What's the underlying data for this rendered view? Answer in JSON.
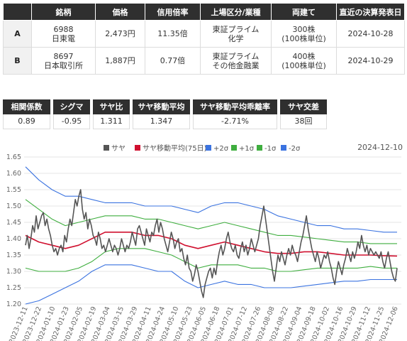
{
  "table": {
    "headers": [
      "",
      "銘柄",
      "価格",
      "信用倍率",
      "上場区分/業種",
      "両建て",
      "直近の決算発表日"
    ],
    "rows": [
      {
        "label": "A",
        "code": "6988",
        "name": "日東電",
        "price": "2,473円",
        "margin_ratio": "11.35倍",
        "market": "東証プライム",
        "sector": "化学",
        "position": "300株",
        "unit": "(100株単位)",
        "earnings_date": "2024-10-28"
      },
      {
        "label": "B",
        "code": "8697",
        "name": "日本取引所",
        "price": "1,887円",
        "margin_ratio": "0.77倍",
        "market": "東証プライム",
        "sector": "その他金融業",
        "position": "400株",
        "unit": "(100株単位)",
        "earnings_date": "2024-10-29"
      }
    ]
  },
  "stats": [
    {
      "label": "相関係数",
      "value": "0.89"
    },
    {
      "label": "シグマ",
      "value": "-0.95"
    },
    {
      "label": "サヤ比",
      "value": "1.311"
    },
    {
      "label": "サヤ移動平均",
      "value": "1.347"
    },
    {
      "label": "サヤ移動平均乖離率",
      "value": "-2.71%"
    },
    {
      "label": "サヤ交差",
      "value": "38回"
    }
  ],
  "chart_data": {
    "type": "line",
    "date_label": "2024-12-10",
    "ylim": [
      1.2,
      1.65
    ],
    "y_ticks": [
      "1.20",
      "1.25",
      "1.30",
      "1.35",
      "1.40",
      "1.45",
      "1.50",
      "1.55",
      "1.60",
      "1.65"
    ],
    "x_ticks": [
      "2023-12-11",
      "2023-12-22",
      "2024-01-10",
      "2024-01-23",
      "2024-02-05",
      "2024-02-19",
      "2024-03-04",
      "2024-03-15",
      "2024-03-29",
      "2024-04-11",
      "2024-04-24",
      "2024-05-10",
      "2024-05-23",
      "2024-06-05",
      "2024-06-18",
      "2024-07-01",
      "2024-07-12",
      "2024-07-26",
      "2024-08-08",
      "2024-08-22",
      "2024-09-04",
      "2024-09-18",
      "2024-10-02",
      "2024-10-16",
      "2024-10-29",
      "2024-11-12",
      "2024-11-25",
      "2024-12-06"
    ],
    "legend": [
      {
        "name": "サヤ",
        "color": "#555555"
      },
      {
        "name": "サヤ移動平均(75日)",
        "color": "#d0102f"
      },
      {
        "name": "+2σ",
        "color": "#3b73e0"
      },
      {
        "name": "+1σ",
        "color": "#3fae3f"
      },
      {
        "name": "-1σ",
        "color": "#3fae3f"
      },
      {
        "name": "-2σ",
        "color": "#3b73e0"
      }
    ],
    "series": [
      {
        "name": "サヤ",
        "color": "#555555",
        "values": [
          1.38,
          1.41,
          1.37,
          1.4,
          1.44,
          1.42,
          1.47,
          1.43,
          1.45,
          1.47,
          1.48,
          1.44,
          1.46,
          1.43,
          1.41,
          1.38,
          1.36,
          1.37,
          1.35,
          1.37,
          1.38,
          1.36,
          1.41,
          1.39,
          1.43,
          1.46,
          1.44,
          1.48,
          1.52,
          1.5,
          1.53,
          1.55,
          1.49,
          1.46,
          1.48,
          1.43,
          1.46,
          1.44,
          1.41,
          1.4,
          1.38,
          1.42,
          1.4,
          1.37,
          1.38,
          1.36,
          1.38,
          1.4,
          1.38,
          1.36,
          1.38,
          1.37,
          1.35,
          1.37,
          1.4,
          1.38,
          1.36,
          1.38,
          1.37,
          1.39,
          1.42,
          1.4,
          1.38,
          1.43,
          1.44,
          1.42,
          1.4,
          1.38,
          1.43,
          1.41,
          1.39,
          1.42,
          1.41,
          1.44,
          1.46,
          1.42,
          1.45,
          1.43,
          1.4,
          1.38,
          1.36,
          1.39,
          1.42,
          1.4,
          1.37,
          1.39,
          1.4,
          1.36,
          1.37,
          1.34,
          1.32,
          1.35,
          1.31,
          1.3,
          1.27,
          1.29,
          1.32,
          1.3,
          1.27,
          1.24,
          1.22,
          1.26,
          1.28,
          1.3,
          1.31,
          1.28,
          1.31,
          1.29,
          1.33,
          1.36,
          1.38,
          1.35,
          1.37,
          1.4,
          1.42,
          1.39,
          1.37,
          1.36,
          1.38,
          1.35,
          1.34,
          1.37,
          1.39,
          1.36,
          1.38,
          1.35,
          1.37,
          1.4,
          1.38,
          1.36,
          1.38,
          1.4,
          1.44,
          1.47,
          1.5,
          1.46,
          1.42,
          1.38,
          1.34,
          1.3,
          1.27,
          1.31,
          1.35,
          1.33,
          1.36,
          1.34,
          1.32,
          1.35,
          1.37,
          1.35,
          1.38,
          1.36,
          1.35,
          1.33,
          1.36,
          1.39,
          1.41,
          1.44,
          1.47,
          1.43,
          1.4,
          1.37,
          1.35,
          1.33,
          1.36,
          1.34,
          1.31,
          1.33,
          1.35,
          1.34,
          1.36,
          1.33,
          1.31,
          1.28,
          1.26,
          1.3,
          1.33,
          1.31,
          1.29,
          1.32,
          1.34,
          1.37,
          1.35,
          1.33,
          1.36,
          1.34,
          1.36,
          1.39,
          1.37,
          1.41,
          1.38,
          1.36,
          1.38,
          1.35,
          1.37,
          1.36,
          1.35,
          1.36,
          1.35,
          1.34,
          1.36,
          1.33,
          1.31,
          1.34,
          1.36,
          1.33,
          1.3,
          1.28,
          1.27,
          1.31
        ]
      },
      {
        "name": "サヤ移動平均(75日)",
        "color": "#d0102f",
        "values": [
          1.41,
          1.39,
          1.38,
          1.37,
          1.38,
          1.4,
          1.42,
          1.42,
          1.42,
          1.41,
          1.41,
          1.4,
          1.38,
          1.37,
          1.38,
          1.39,
          1.38,
          1.37,
          1.36,
          1.355,
          1.355,
          1.36,
          1.36,
          1.355,
          1.35,
          1.35,
          1.35,
          1.348,
          1.347
        ]
      },
      {
        "name": "+2σ",
        "color": "#3b73e0",
        "values": [
          1.62,
          1.58,
          1.55,
          1.53,
          1.53,
          1.52,
          1.51,
          1.51,
          1.51,
          1.5,
          1.5,
          1.5,
          1.49,
          1.48,
          1.5,
          1.51,
          1.51,
          1.5,
          1.49,
          1.47,
          1.46,
          1.45,
          1.44,
          1.44,
          1.43,
          1.43,
          1.425,
          1.42,
          1.42
        ]
      },
      {
        "name": "+1σ",
        "color": "#3fae3f",
        "values": [
          1.52,
          1.49,
          1.46,
          1.44,
          1.45,
          1.46,
          1.47,
          1.47,
          1.47,
          1.46,
          1.46,
          1.45,
          1.44,
          1.43,
          1.44,
          1.45,
          1.44,
          1.43,
          1.42,
          1.41,
          1.41,
          1.405,
          1.4,
          1.395,
          1.39,
          1.39,
          1.385,
          1.385,
          1.385
        ]
      },
      {
        "name": "-1σ",
        "color": "#3fae3f",
        "values": [
          1.31,
          1.3,
          1.3,
          1.3,
          1.31,
          1.33,
          1.36,
          1.37,
          1.37,
          1.37,
          1.36,
          1.35,
          1.33,
          1.31,
          1.32,
          1.32,
          1.32,
          1.31,
          1.31,
          1.3,
          1.3,
          1.305,
          1.31,
          1.31,
          1.31,
          1.31,
          1.315,
          1.31,
          1.31
        ]
      },
      {
        "name": "-2σ",
        "color": "#3b73e0",
        "values": [
          1.2,
          1.21,
          1.23,
          1.25,
          1.27,
          1.3,
          1.32,
          1.32,
          1.32,
          1.31,
          1.3,
          1.3,
          1.27,
          1.25,
          1.26,
          1.27,
          1.26,
          1.26,
          1.25,
          1.25,
          1.25,
          1.255,
          1.26,
          1.265,
          1.27,
          1.27,
          1.275,
          1.275,
          1.275
        ]
      }
    ]
  }
}
